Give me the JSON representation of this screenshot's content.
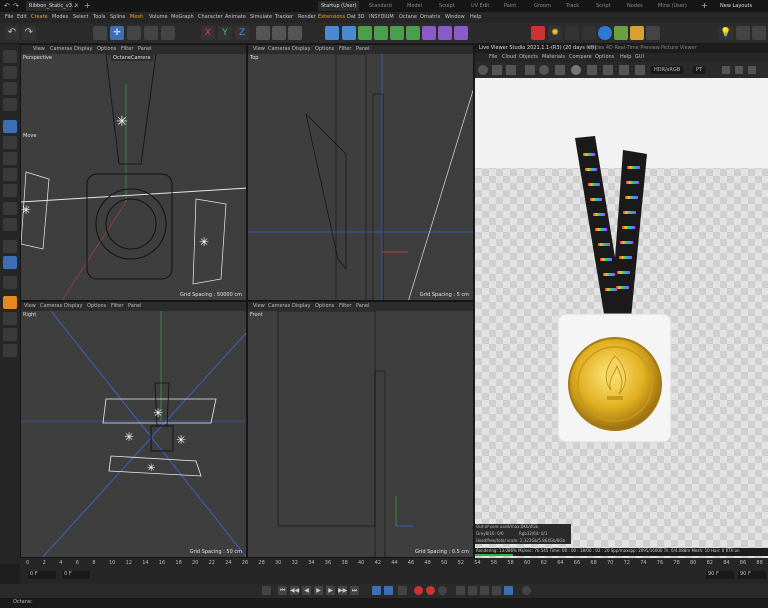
{
  "window": {
    "doc_tab": "Ribbon_Static_v3...",
    "layout_tabs": [
      "Startup (User)",
      "Standard",
      "Model",
      "Sculpt",
      "UV Edit",
      "Paint",
      "Groom",
      "Track",
      "Script",
      "Nodes",
      "Mine (User)"
    ],
    "new_layouts": "New Layouts"
  },
  "menubar": {
    "items": [
      "File",
      "Edit",
      "Create",
      "Modes",
      "Select",
      "Tools",
      "Spline",
      "Mesh",
      "Volume",
      "MoGraph",
      "Character",
      "Animate",
      "Simulate",
      "Tracker",
      "Render",
      "Extensions",
      "Dat 3D",
      "INSYDIUM",
      "Octane",
      "Ornatrix",
      "Window",
      "Help"
    ]
  },
  "viewport_menu": [
    "View",
    "Cameras",
    "Display",
    "Options",
    "Filter",
    "Panel"
  ],
  "viewports": {
    "perspective": {
      "label": "Perspective",
      "camera": "OctaneCamera",
      "move_label": "Move",
      "grid": "Grid Spacing : 50000 cm"
    },
    "top": {
      "label": "Top",
      "grid": "Grid Spacing : 5 cm"
    },
    "right": {
      "label": "Right",
      "grid": "Grid Spacing : 50 cm"
    },
    "front": {
      "label": "Front",
      "grid": "Grid Spacing : 0.5 cm"
    }
  },
  "octane": {
    "title": "Live Viewer Studio 2021.1.1-(R3) (20 days left)",
    "tab2": "Cycles 4D Real-Time Preview",
    "tab3": "Picture Viewer",
    "menu": [
      "File",
      "Cloud",
      "Objects",
      "Materials",
      "Compare",
      "Options",
      "Help",
      "GUI"
    ],
    "mode": "HDR/sRGB",
    "mode2": "PT",
    "stats": {
      "line1": "Out-of-core used/max:0Kb/4Gb",
      "line2": "Grey8/16: 0/0",
      "line2b": "Rgb32/64: 0/1",
      "line3": "Used/free/total vram: 2.321Gb/5.864Gb/8Gb",
      "bar": "Rendering: 13.086%  Ms/sec: 76.545  Time: 00 : 00 : 18/00 : 02 : 20  Spp/maxspp: 2095/16000  Tri: 0/4.088m  Mesh: 10  Hair: 0  RTX:on"
    }
  },
  "timeline": {
    "ticks": [
      "0",
      "2",
      "4",
      "6",
      "8",
      "10",
      "12",
      "14",
      "16",
      "18",
      "20",
      "22",
      "24",
      "26",
      "28",
      "30",
      "32",
      "34",
      "36",
      "38",
      "40",
      "42",
      "44",
      "46",
      "48",
      "50",
      "52",
      "54",
      "56",
      "58",
      "60",
      "62",
      "64",
      "66",
      "68",
      "70",
      "72",
      "74",
      "76",
      "78",
      "80",
      "82",
      "84",
      "86",
      "88",
      "90"
    ],
    "current_frame": "0 F",
    "start_frame": "0 F",
    "end_frame": "90 F",
    "end_frame2": "90 F"
  },
  "status": {
    "text": "Octane:"
  },
  "colors": {
    "accent": "#f0a030",
    "medal_gold": "#e0b020"
  }
}
